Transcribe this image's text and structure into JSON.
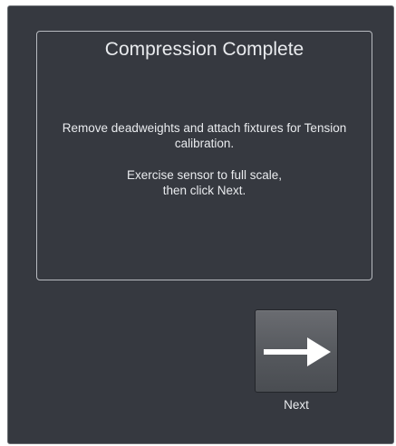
{
  "dialog": {
    "title": "Compression Complete",
    "message_line1": "Remove deadweights and attach fixtures for Tension\ncalibration.",
    "message_line2": "Exercise sensor to full scale,\nthen click Next."
  },
  "next_button": {
    "label": "Next",
    "icon": "arrow-right-icon"
  },
  "colors": {
    "background": "#363940",
    "text": "#e9ebee",
    "panel_border": "#b8bbc0",
    "icon": "#ffffff"
  }
}
